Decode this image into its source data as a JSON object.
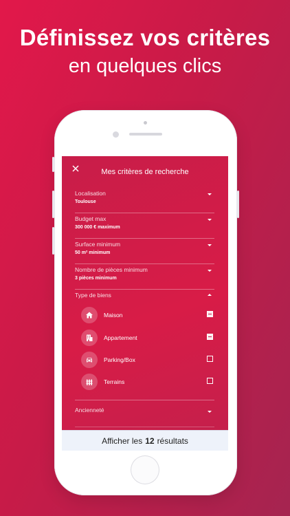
{
  "hero": {
    "headline": "Définissez vos critères",
    "subline": "en quelques clics"
  },
  "screen": {
    "title": "Mes critères de recherche",
    "close_icon": "close-icon",
    "criteria": [
      {
        "label": "Localisation",
        "value": "Toulouse"
      },
      {
        "label": "Budget max",
        "value": "300 000 € maximum"
      },
      {
        "label": "Surface minimum",
        "value": "50 m² minimum"
      },
      {
        "label": "Nombre de pièces minimum",
        "value": "3 pièces minimum"
      }
    ],
    "property_types": {
      "label": "Type de biens",
      "items": [
        {
          "label": "Maison",
          "icon": "house-icon",
          "checked": true
        },
        {
          "label": "Appartement",
          "icon": "building-icon",
          "checked": true
        },
        {
          "label": "Parking/Box",
          "icon": "car-icon",
          "checked": false
        },
        {
          "label": "Terrains",
          "icon": "fence-icon",
          "checked": false
        }
      ]
    },
    "age": {
      "label": "Ancienneté"
    },
    "cta": {
      "prefix": "Afficher les",
      "count": "12",
      "suffix": "résultats"
    }
  },
  "colors": {
    "background_start": "#e2184a",
    "background_end": "#a52450",
    "screen_accent": "#d81c47",
    "cta_background": "#eef2fa"
  }
}
